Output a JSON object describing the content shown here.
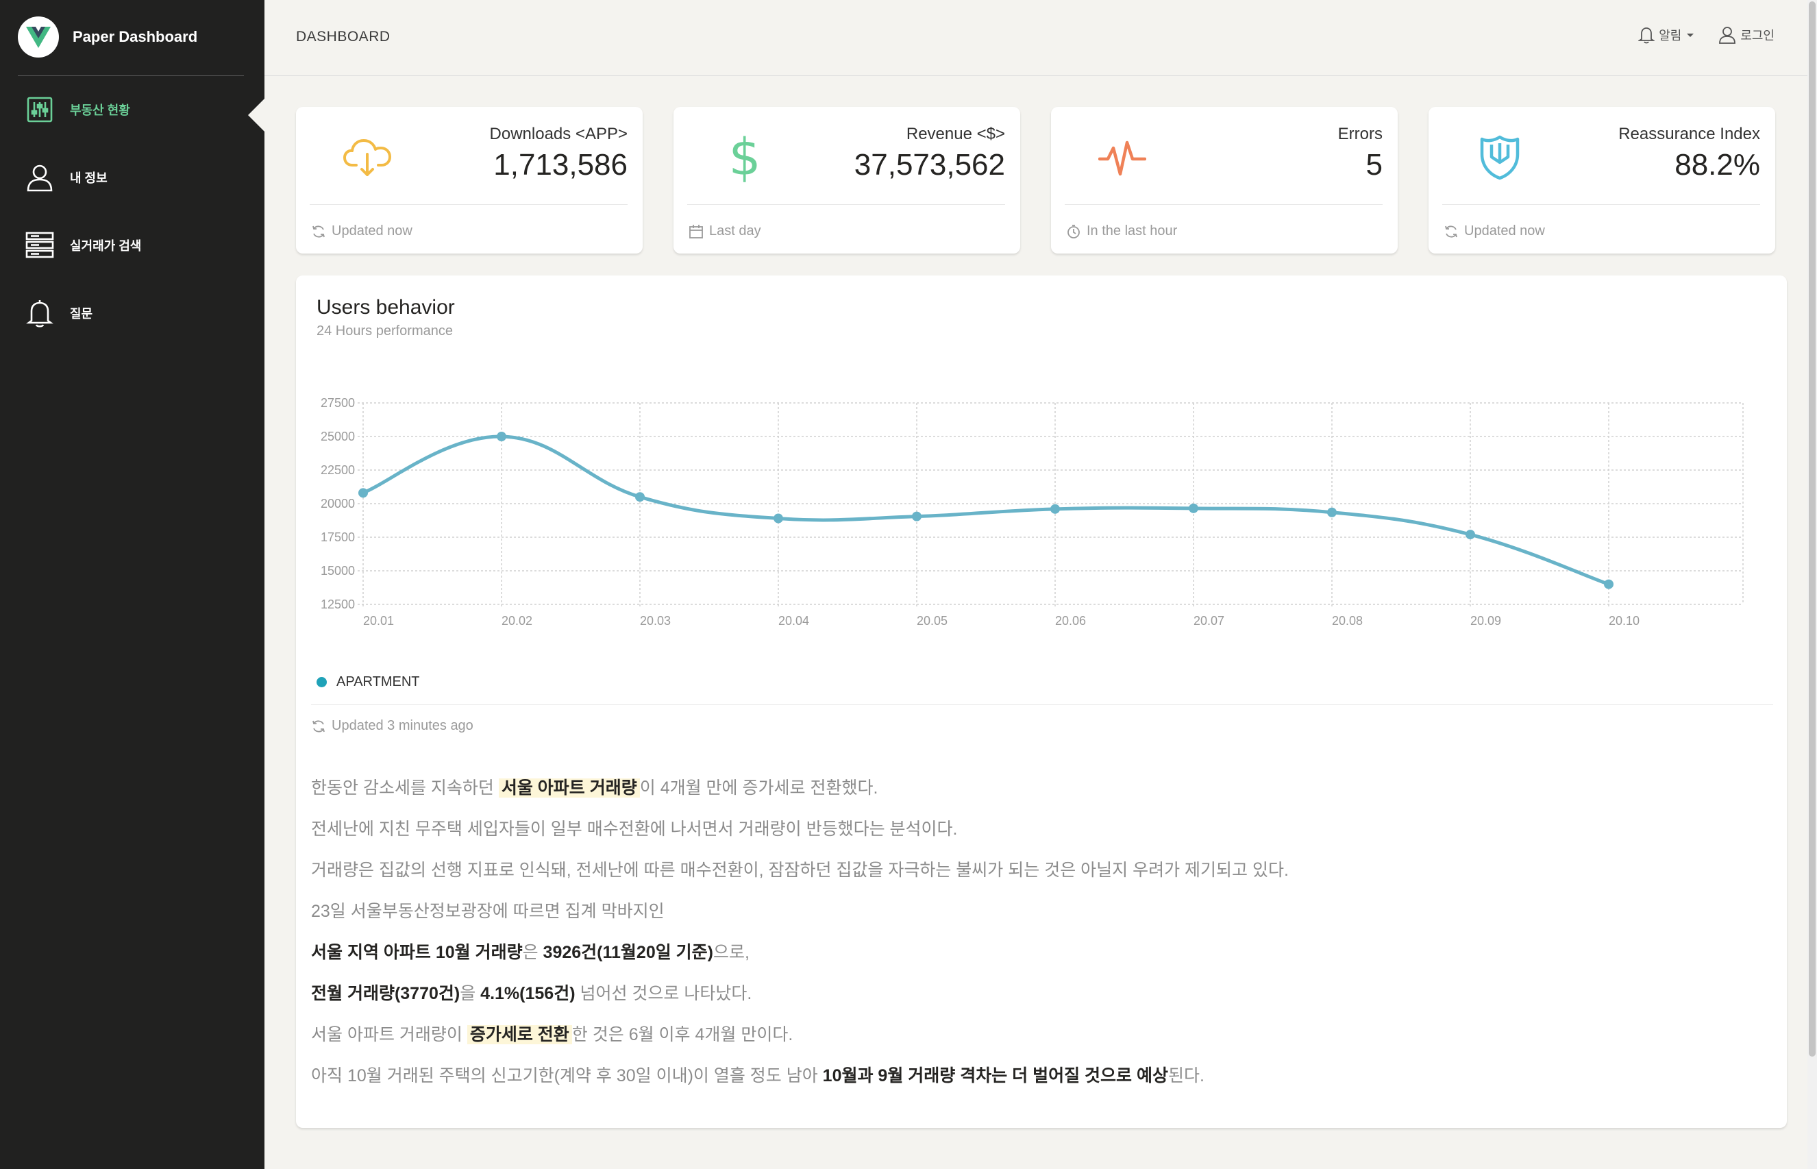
{
  "app": {
    "logo_text": "Paper Dashboard",
    "accent": "#6bd098"
  },
  "sidebar": {
    "items": [
      {
        "label": "부동산 현황",
        "icon": "sliders-icon",
        "active": true
      },
      {
        "label": "내 정보",
        "icon": "user-icon",
        "active": false
      },
      {
        "label": "실거래가 검색",
        "icon": "server-icon",
        "active": false
      },
      {
        "label": "질문",
        "icon": "bell-icon",
        "active": false
      }
    ]
  },
  "topbar": {
    "title": "DASHBOARD",
    "notifications_label": "알림",
    "login_label": "로그인"
  },
  "stats": [
    {
      "category": "Downloads <APP>",
      "value": "1,713,586",
      "footer": "Updated now",
      "icon": "cloud-download-icon",
      "color": "#f3bb45"
    },
    {
      "category": "Revenue <$>",
      "value": "37,573,562",
      "footer": "Last day",
      "icon": "dollar-icon",
      "color": "#6bd098"
    },
    {
      "category": "Errors",
      "value": "5",
      "footer": "In the last hour",
      "icon": "pulse-icon",
      "color": "#ef8157"
    },
    {
      "category": "Reassurance Index",
      "value": "88.2%",
      "footer": "Updated now",
      "icon": "shield-icon",
      "color": "#51bcda"
    }
  ],
  "users_card": {
    "title": "Users behavior",
    "subtitle": "24 Hours performance",
    "legend": "APARTMENT",
    "footer": "Updated 3 minutes ago"
  },
  "chart_data": {
    "type": "line",
    "title": "Users behavior",
    "subtitle": "24 Hours performance",
    "x": [
      "20.01",
      "20.02",
      "20.03",
      "20.04",
      "20.05",
      "20.06",
      "20.07",
      "20.08",
      "20.09",
      "20.10"
    ],
    "series": [
      {
        "name": "APARTMENT",
        "values": [
          20800,
          25000,
          20500,
          18900,
          19050,
          19600,
          19650,
          19350,
          17700,
          14000
        ],
        "color": "#68b3c8"
      }
    ],
    "yticks": [
      12500,
      15000,
      17500,
      20000,
      22500,
      25000,
      27500
    ],
    "ylim": [
      12500,
      27500
    ],
    "grid": true
  },
  "article": {
    "l1": {
      "a": "한동안 감소세를 지속하던 ",
      "b": "서울 아파트 거래량",
      "c": "이 4개월 만에 증가세로 전환했다."
    },
    "l2": "전세난에 지친 무주택 세입자들이 일부 매수전환에 나서면서 거래량이 반등했다는 분석이다.",
    "l3": "거래량은 집값의 선행 지표로 인식돼, 전세난에 따른 매수전환이, 잠잠하던 집값을 자극하는 불씨가 되는 것은 아닐지 우려가 제기되고 있다.",
    "l4": "23일 서울부동산정보광장에 따르면 집계 막바지인",
    "l5": {
      "a": "서울 지역 아파트 10월 거래량",
      "b": "은 ",
      "c": "3926건(11월20일 기준)",
      "d": "으로,"
    },
    "l6": {
      "a": "전월 거래량(3770건)",
      "b": "을 ",
      "c": "4.1%(156건)",
      "d": " 넘어선 것으로 나타났다."
    },
    "l7": {
      "a": "서울 아파트 거래량이 ",
      "b": "증가세로 전환",
      "c": "한 것은 6월 이후 4개월 만이다."
    },
    "l8": {
      "a": "아직 10월 거래된 주택의 신고기한(계약 후 30일 이내)이 열흘 정도 남아 ",
      "b": "10월과 9월 거래량 격차는 더 벌어질 것으로 예상",
      "c": "된다."
    }
  }
}
